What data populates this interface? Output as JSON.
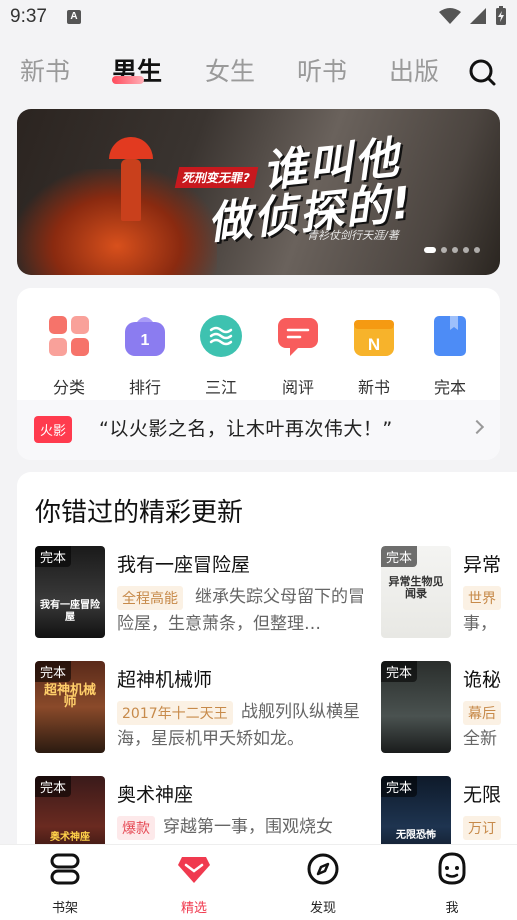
{
  "status": {
    "time": "9:37",
    "notification_glyph": "A"
  },
  "tabs": [
    {
      "label": "新书"
    },
    {
      "label": "男生"
    },
    {
      "label": "女生"
    },
    {
      "label": "听书"
    },
    {
      "label": "出版"
    }
  ],
  "active_tab": "男生",
  "banner": {
    "tag": "死刑变无罪?",
    "title_line1": "谁叫他",
    "title_line2": "做侦探的!",
    "author": "青衫仗剑行天涯/著",
    "slide_count": 5,
    "active_slide": 1
  },
  "categories": [
    {
      "label": "分类",
      "icon": "grid-icon",
      "color": "#f6736a"
    },
    {
      "label": "排行",
      "icon": "rank-icon",
      "color": "#8b7cf0"
    },
    {
      "label": "三江",
      "icon": "wave-icon",
      "color": "#3ec2b0"
    },
    {
      "label": "阅评",
      "icon": "comment-icon",
      "color": "#f85c5c"
    },
    {
      "label": "新书",
      "icon": "calendar-icon",
      "color": "#f7b32b"
    },
    {
      "label": "完本",
      "icon": "book-icon",
      "color": "#4d8cf6"
    }
  ],
  "news": {
    "badge": "火影",
    "text": "“以火影之名，让木叶再次伟大！”"
  },
  "updates": {
    "title": "你错过的精彩更新",
    "books": [
      {
        "name": "我有一座冒险屋",
        "badge": "完本",
        "cover_text": "我有一座冒险屋",
        "tag": "全程高能",
        "desc": "继承失踪父母留下的冒险屋，生意萧条，但整理…"
      },
      {
        "name": "异常",
        "badge": "完本",
        "cover_text": "异常生物见闻录",
        "tag": "世界",
        "desc": "事，"
      },
      {
        "name": "超神机械师",
        "badge": "完本",
        "cover_text": "超神机械师",
        "tag": "2017年十二天王",
        "desc": "战舰列队纵横星海，星辰机甲夭矫如龙。"
      },
      {
        "name": "诡秘",
        "badge": "完本",
        "cover_text": "",
        "tag": "幕后",
        "desc": "全新"
      },
      {
        "name": "奥术神座",
        "badge": "完本",
        "cover_text": "奥术神座",
        "tag": "爆款",
        "desc": "穿越第一事，围观烧女"
      },
      {
        "name": "无限",
        "badge": "完本",
        "cover_text": "无限恐怖",
        "tag": "万订",
        "desc": ""
      }
    ]
  },
  "bottom_nav": [
    {
      "label": "书架",
      "icon": "bookshelf-icon"
    },
    {
      "label": "精选",
      "icon": "diamond-icon"
    },
    {
      "label": "发现",
      "icon": "compass-icon"
    },
    {
      "label": "我",
      "icon": "face-icon"
    }
  ],
  "colors": {
    "accent": "#f03a4f",
    "tag_bg": "#fbf1e4",
    "tag_fg": "#c78a4a",
    "hot_tag_bg": "#fde9ea",
    "hot_tag_fg": "#e64a55"
  }
}
